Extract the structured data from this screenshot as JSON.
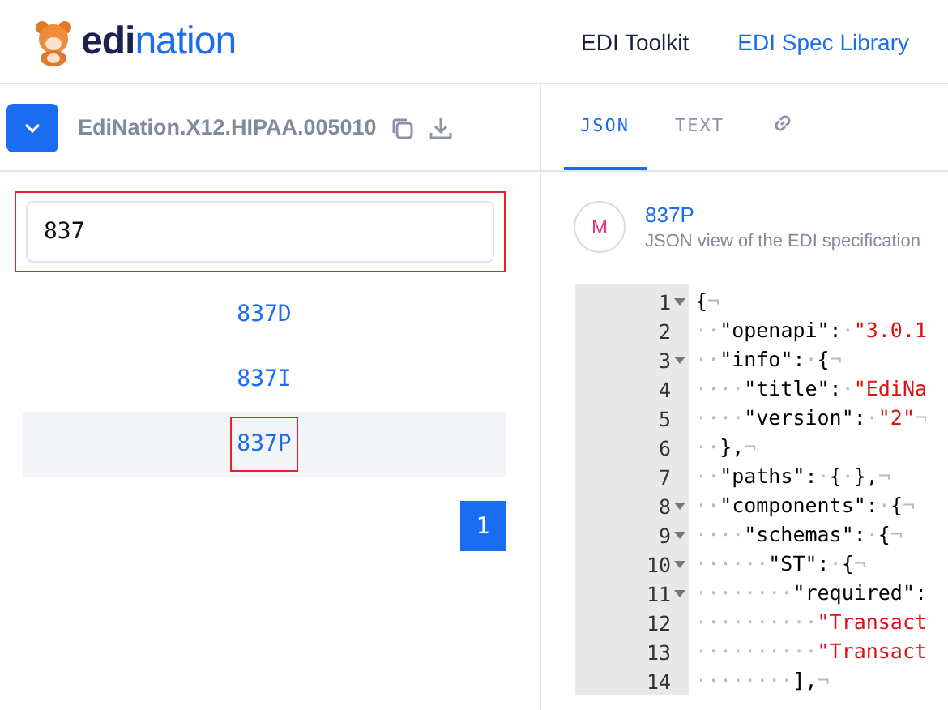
{
  "header": {
    "logo_text": "**edi**nation",
    "nav": [
      {
        "label": "EDI Toolkit",
        "selected": false
      },
      {
        "label": "EDI Spec Library",
        "selected": true
      }
    ]
  },
  "left": {
    "spec_name": "EdiNation.X12.HIPAA.005010",
    "search": {
      "value": "837",
      "highlighted": true
    },
    "results": [
      {
        "label": "837D",
        "selected": false,
        "highlighted": false
      },
      {
        "label": "837I",
        "selected": false,
        "highlighted": false
      },
      {
        "label": "837P",
        "selected": true,
        "highlighted": true
      }
    ],
    "pages": [
      {
        "label": "1",
        "selected": true
      }
    ]
  },
  "right": {
    "tabs": [
      {
        "label": "JSON",
        "kind": "text",
        "selected": true
      },
      {
        "label": "TEXT",
        "kind": "text",
        "selected": false
      },
      {
        "kind": "link",
        "selected": false
      }
    ],
    "spec": {
      "avatar": "M",
      "title": "837P",
      "subtitle": "JSON view of the EDI specification"
    },
    "code": [
      {
        "number": "1",
        "fold": true,
        "tokens": [
          {
            "kind": "punct",
            "text": "{"
          },
          {
            "kind": "eol",
            "text": "¬"
          }
        ]
      },
      {
        "number": "2",
        "fold": false,
        "tokens": [
          {
            "kind": "ws",
            "text": "··"
          },
          {
            "kind": "key",
            "text": "\"openapi\""
          },
          {
            "kind": "punct",
            "text": ":"
          },
          {
            "kind": "ws",
            "text": "·"
          },
          {
            "kind": "string",
            "text": "\"3.0.1"
          }
        ]
      },
      {
        "number": "3",
        "fold": true,
        "tokens": [
          {
            "kind": "ws",
            "text": "··"
          },
          {
            "kind": "key",
            "text": "\"info\""
          },
          {
            "kind": "punct",
            "text": ":"
          },
          {
            "kind": "ws",
            "text": "·"
          },
          {
            "kind": "punct",
            "text": "{"
          },
          {
            "kind": "eol",
            "text": "¬"
          }
        ]
      },
      {
        "number": "4",
        "fold": false,
        "tokens": [
          {
            "kind": "ws",
            "text": "····"
          },
          {
            "kind": "key",
            "text": "\"title\""
          },
          {
            "kind": "punct",
            "text": ":"
          },
          {
            "kind": "ws",
            "text": "·"
          },
          {
            "kind": "string",
            "text": "\"EdiNa"
          }
        ]
      },
      {
        "number": "5",
        "fold": false,
        "tokens": [
          {
            "kind": "ws",
            "text": "····"
          },
          {
            "kind": "key",
            "text": "\"version\""
          },
          {
            "kind": "punct",
            "text": ":"
          },
          {
            "kind": "ws",
            "text": "·"
          },
          {
            "kind": "string",
            "text": "\"2\""
          },
          {
            "kind": "eol",
            "text": "¬"
          }
        ]
      },
      {
        "number": "6",
        "fold": false,
        "tokens": [
          {
            "kind": "ws",
            "text": "··"
          },
          {
            "kind": "punct",
            "text": "},"
          },
          {
            "kind": "eol",
            "text": "¬"
          }
        ]
      },
      {
        "number": "7",
        "fold": false,
        "tokens": [
          {
            "kind": "ws",
            "text": "··"
          },
          {
            "kind": "key",
            "text": "\"paths\""
          },
          {
            "kind": "punct",
            "text": ":"
          },
          {
            "kind": "ws",
            "text": "·"
          },
          {
            "kind": "punct",
            "text": "{"
          },
          {
            "kind": "ws",
            "text": "·"
          },
          {
            "kind": "punct",
            "text": "},"
          },
          {
            "kind": "eol",
            "text": "¬"
          }
        ]
      },
      {
        "number": "8",
        "fold": true,
        "tokens": [
          {
            "kind": "ws",
            "text": "··"
          },
          {
            "kind": "key",
            "text": "\"components\""
          },
          {
            "kind": "punct",
            "text": ":"
          },
          {
            "kind": "ws",
            "text": "·"
          },
          {
            "kind": "punct",
            "text": "{"
          },
          {
            "kind": "eol",
            "text": "¬"
          }
        ]
      },
      {
        "number": "9",
        "fold": true,
        "tokens": [
          {
            "kind": "ws",
            "text": "····"
          },
          {
            "kind": "key",
            "text": "\"schemas\""
          },
          {
            "kind": "punct",
            "text": ":"
          },
          {
            "kind": "ws",
            "text": "·"
          },
          {
            "kind": "punct",
            "text": "{"
          },
          {
            "kind": "eol",
            "text": "¬"
          }
        ]
      },
      {
        "number": "10",
        "fold": true,
        "tokens": [
          {
            "kind": "ws",
            "text": "······"
          },
          {
            "kind": "key",
            "text": "\"ST\""
          },
          {
            "kind": "punct",
            "text": ":"
          },
          {
            "kind": "ws",
            "text": "·"
          },
          {
            "kind": "punct",
            "text": "{"
          },
          {
            "kind": "eol",
            "text": "¬"
          }
        ]
      },
      {
        "number": "11",
        "fold": true,
        "tokens": [
          {
            "kind": "ws",
            "text": "········"
          },
          {
            "kind": "key",
            "text": "\"required\""
          },
          {
            "kind": "punct",
            "text": ":"
          }
        ]
      },
      {
        "number": "12",
        "fold": false,
        "tokens": [
          {
            "kind": "ws",
            "text": "··········"
          },
          {
            "kind": "string",
            "text": "\"Transact"
          }
        ]
      },
      {
        "number": "13",
        "fold": false,
        "tokens": [
          {
            "kind": "ws",
            "text": "··········"
          },
          {
            "kind": "string",
            "text": "\"Transact"
          }
        ]
      },
      {
        "number": "14",
        "fold": false,
        "tokens": [
          {
            "kind": "ws",
            "text": "········"
          },
          {
            "kind": "punct",
            "text": "],"
          },
          {
            "kind": "eol",
            "text": "¬"
          }
        ]
      }
    ]
  }
}
